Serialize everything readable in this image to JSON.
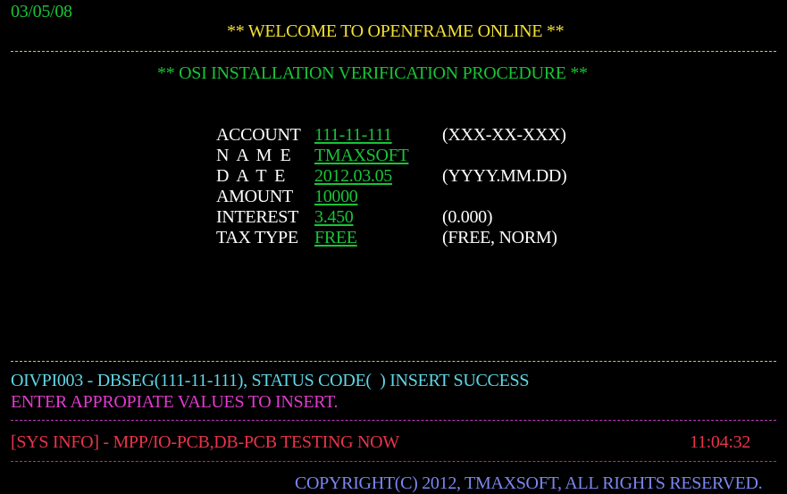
{
  "header": {
    "date": "03/05/08",
    "title": "** WELCOME TO OPENFRAME ONLINE **"
  },
  "subtitle": "** OSI INSTALLATION VERIFICATION PROCEDURE **",
  "form": {
    "account": {
      "label": "ACCOUNT",
      "value": "111-11-111",
      "format": "(XXX-XX-XXX)"
    },
    "name": {
      "label": "N A M E",
      "value": "TMAXSOFT",
      "format": ""
    },
    "date": {
      "label": "D A T E",
      "value": "2012.03.05",
      "format": "(YYYY.MM.DD)"
    },
    "amount": {
      "label": "AMOUNT",
      "value": "10000",
      "format": ""
    },
    "interest": {
      "label": "INTEREST",
      "value": "3.450",
      "format": "(0.000)"
    },
    "tax_type": {
      "label": "TAX TYPE",
      "value": "FREE",
      "format": "(FREE, NORM)"
    }
  },
  "messages": {
    "status": "OIVPI003 - DBSEG(111-11-111), STATUS CODE(  ) INSERT SUCCESS",
    "prompt": "ENTER APPROPIATE VALUES TO INSERT."
  },
  "sysinfo": {
    "text": "[SYS INFO] - MPP/IO-PCB,DB-PCB TESTING NOW",
    "time": "11:04:32"
  },
  "footer": {
    "copyright": "COPYRIGHT(C) 2012, TMAXSOFT, ALL RIGHTS RESERVED."
  },
  "colors": {
    "background": "#000000",
    "green": "#19c437",
    "yellow": "#f2e033",
    "white": "#ffffff",
    "cyan": "#5fd7e6",
    "magenta": "#e23bd0",
    "red": "#e8344a",
    "blue": "#7b86f0",
    "divider_yellow": "#d8c82c",
    "divider_cyan": "#5fc8d8",
    "divider_magenta": "#c23ab8",
    "divider_red": "#d03040"
  }
}
